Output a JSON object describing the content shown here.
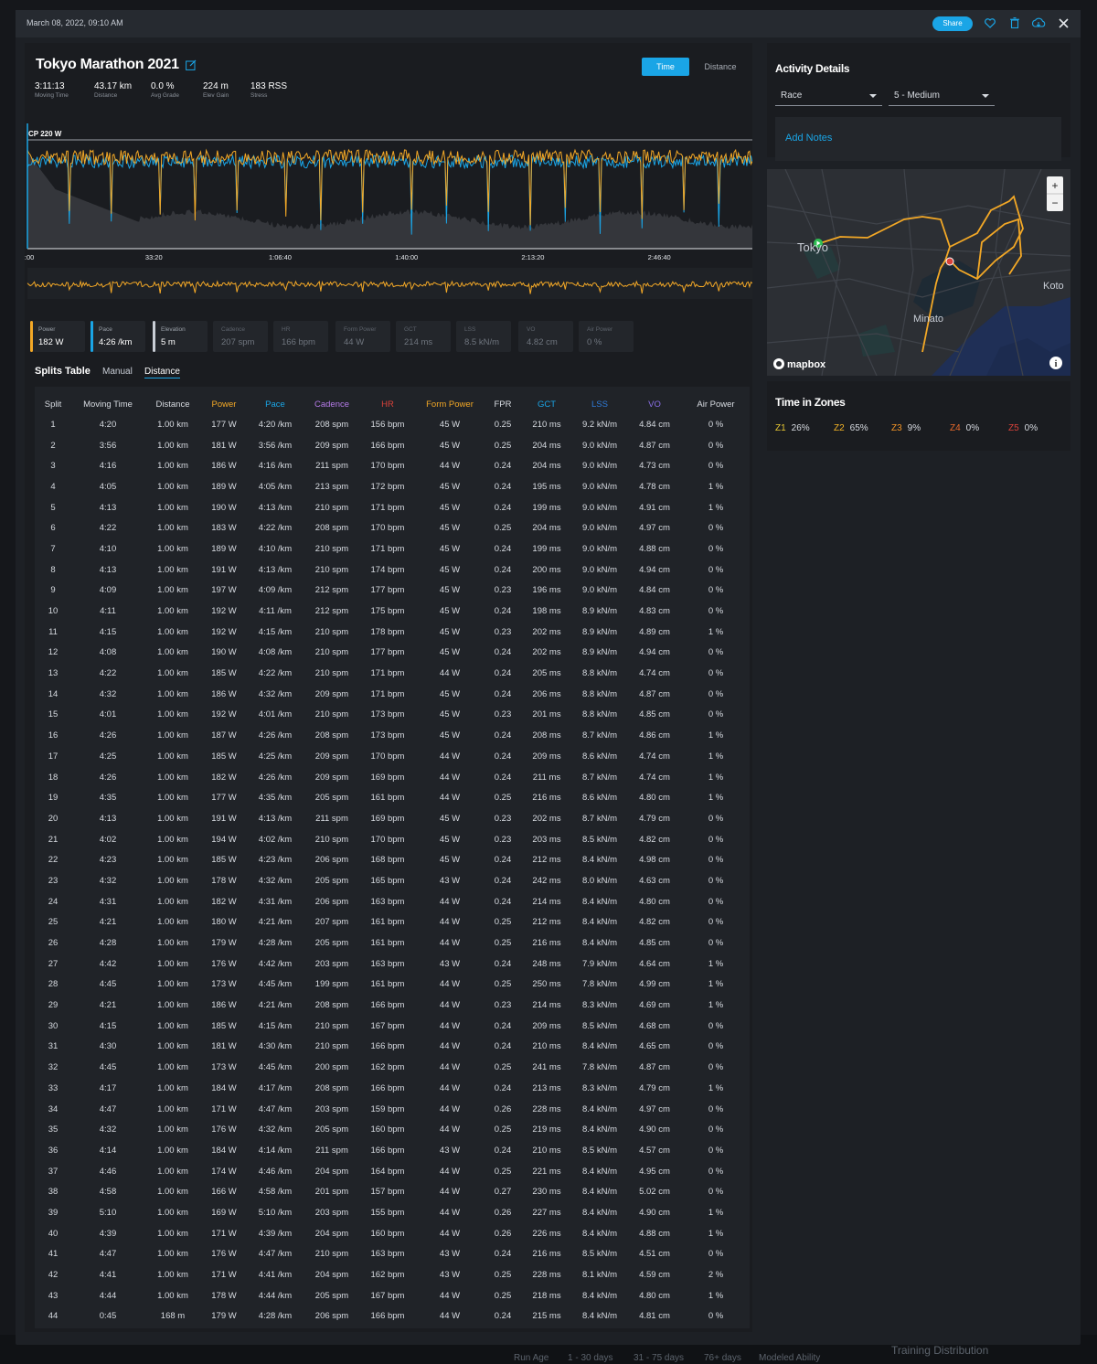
{
  "header": {
    "date": "March 08, 2022, 09:10 AM",
    "share_label": "Share"
  },
  "activity": {
    "title": "Tokyo Marathon 2021",
    "stats": [
      {
        "value": "3:11:13",
        "label": "Moving Time"
      },
      {
        "value": "43.17 km",
        "label": "Distance"
      },
      {
        "value": "0.0 %",
        "label": "Avg Grade"
      },
      {
        "value": "224 m",
        "label": "Elev Gain"
      },
      {
        "value": "183 RSS",
        "label": "Stress"
      }
    ],
    "toggle": {
      "time": "Time",
      "distance": "Distance"
    }
  },
  "chart_data": {
    "type": "line",
    "title": "",
    "cp_label": "CP 220 W",
    "x_ticks": [
      "0:00",
      "33:20",
      "1:06:40",
      "1:40:00",
      "2:13:20",
      "2:46:40"
    ],
    "series": [
      {
        "name": "Power",
        "color": "#f3a826"
      },
      {
        "name": "Pace",
        "color": "#1aa5e6"
      },
      {
        "name": "Elevation",
        "color": "#8c9099"
      }
    ],
    "grid": false
  },
  "metrics": [
    {
      "label": "Power",
      "value": "182 W",
      "color": "#f3a826",
      "active": true
    },
    {
      "label": "Pace",
      "value": "4:26 /km",
      "color": "#1aa5e6",
      "active": true
    },
    {
      "label": "Elevation",
      "value": "5 m",
      "color": "#c9ced6",
      "active": true
    },
    {
      "label": "Cadence",
      "value": "207 spm",
      "active": false
    },
    {
      "label": "HR",
      "value": "166 bpm",
      "active": false
    },
    {
      "label": "Form Power",
      "value": "44 W",
      "active": false
    },
    {
      "label": "GCT",
      "value": "214 ms",
      "active": false
    },
    {
      "label": "LSS",
      "value": "8.5 kN/m",
      "active": false
    },
    {
      "label": "VO",
      "value": "4.82 cm",
      "active": false
    },
    {
      "label": "Air Power",
      "value": "0 %",
      "active": false
    }
  ],
  "splits_tabs": {
    "title": "Splits Table",
    "manual": "Manual",
    "distance": "Distance"
  },
  "splits": {
    "columns": [
      {
        "label": "Split",
        "color": "#d8dce2"
      },
      {
        "label": "Moving Time",
        "color": "#d8dce2"
      },
      {
        "label": "Distance",
        "color": "#d8dce2"
      },
      {
        "label": "Power",
        "color": "#f3a826"
      },
      {
        "label": "Pace",
        "color": "#1aa5e6"
      },
      {
        "label": "Cadence",
        "color": "#b57be8"
      },
      {
        "label": "HR",
        "color": "#d9423a"
      },
      {
        "label": "Form Power",
        "color": "#f3a826"
      },
      {
        "label": "FPR",
        "color": "#d8dce2"
      },
      {
        "label": "GCT",
        "color": "#1aa5e6"
      },
      {
        "label": "LSS",
        "color": "#2f7bd9"
      },
      {
        "label": "VO",
        "color": "#8a6ee6"
      },
      {
        "label": "Air Power",
        "color": "#d8dce2"
      }
    ],
    "rows": [
      [
        "1",
        "4:20",
        "1.00 km",
        "177 W",
        "4:20 /km",
        "208 spm",
        "156 bpm",
        "45 W",
        "0.25",
        "210 ms",
        "9.2 kN/m",
        "4.84 cm",
        "0 %"
      ],
      [
        "2",
        "3:56",
        "1.00 km",
        "181 W",
        "3:56 /km",
        "209 spm",
        "166 bpm",
        "45 W",
        "0.25",
        "204 ms",
        "9.0 kN/m",
        "4.87 cm",
        "0 %"
      ],
      [
        "3",
        "4:16",
        "1.00 km",
        "186 W",
        "4:16 /km",
        "211 spm",
        "170 bpm",
        "44 W",
        "0.24",
        "204 ms",
        "9.0 kN/m",
        "4.73 cm",
        "0 %"
      ],
      [
        "4",
        "4:05",
        "1.00 km",
        "189 W",
        "4:05 /km",
        "213 spm",
        "172 bpm",
        "45 W",
        "0.24",
        "195 ms",
        "9.0 kN/m",
        "4.78 cm",
        "1 %"
      ],
      [
        "5",
        "4:13",
        "1.00 km",
        "190 W",
        "4:13 /km",
        "210 spm",
        "171 bpm",
        "45 W",
        "0.24",
        "199 ms",
        "9.0 kN/m",
        "4.91 cm",
        "1 %"
      ],
      [
        "6",
        "4:22",
        "1.00 km",
        "183 W",
        "4:22 /km",
        "208 spm",
        "170 bpm",
        "45 W",
        "0.25",
        "204 ms",
        "9.0 kN/m",
        "4.97 cm",
        "0 %"
      ],
      [
        "7",
        "4:10",
        "1.00 km",
        "189 W",
        "4:10 /km",
        "210 spm",
        "171 bpm",
        "45 W",
        "0.24",
        "199 ms",
        "9.0 kN/m",
        "4.88 cm",
        "0 %"
      ],
      [
        "8",
        "4:13",
        "1.00 km",
        "191 W",
        "4:13 /km",
        "210 spm",
        "174 bpm",
        "45 W",
        "0.24",
        "200 ms",
        "9.0 kN/m",
        "4.94 cm",
        "0 %"
      ],
      [
        "9",
        "4:09",
        "1.00 km",
        "197 W",
        "4:09 /km",
        "212 spm",
        "177 bpm",
        "45 W",
        "0.23",
        "196 ms",
        "9.0 kN/m",
        "4.84 cm",
        "0 %"
      ],
      [
        "10",
        "4:11",
        "1.00 km",
        "192 W",
        "4:11 /km",
        "212 spm",
        "175 bpm",
        "45 W",
        "0.24",
        "198 ms",
        "8.9 kN/m",
        "4.83 cm",
        "0 %"
      ],
      [
        "11",
        "4:15",
        "1.00 km",
        "192 W",
        "4:15 /km",
        "210 spm",
        "178 bpm",
        "45 W",
        "0.23",
        "202 ms",
        "8.9 kN/m",
        "4.89 cm",
        "1 %"
      ],
      [
        "12",
        "4:08",
        "1.00 km",
        "190 W",
        "4:08 /km",
        "210 spm",
        "177 bpm",
        "45 W",
        "0.24",
        "202 ms",
        "8.9 kN/m",
        "4.94 cm",
        "0 %"
      ],
      [
        "13",
        "4:22",
        "1.00 km",
        "185 W",
        "4:22 /km",
        "210 spm",
        "171 bpm",
        "44 W",
        "0.24",
        "205 ms",
        "8.8 kN/m",
        "4.74 cm",
        "0 %"
      ],
      [
        "14",
        "4:32",
        "1.00 km",
        "186 W",
        "4:32 /km",
        "209 spm",
        "171 bpm",
        "45 W",
        "0.24",
        "206 ms",
        "8.8 kN/m",
        "4.87 cm",
        "0 %"
      ],
      [
        "15",
        "4:01",
        "1.00 km",
        "192 W",
        "4:01 /km",
        "210 spm",
        "173 bpm",
        "45 W",
        "0.23",
        "201 ms",
        "8.8 kN/m",
        "4.85 cm",
        "0 %"
      ],
      [
        "16",
        "4:26",
        "1.00 km",
        "187 W",
        "4:26 /km",
        "208 spm",
        "173 bpm",
        "45 W",
        "0.24",
        "208 ms",
        "8.7 kN/m",
        "4.86 cm",
        "1 %"
      ],
      [
        "17",
        "4:25",
        "1.00 km",
        "185 W",
        "4:25 /km",
        "209 spm",
        "170 bpm",
        "44 W",
        "0.24",
        "209 ms",
        "8.6 kN/m",
        "4.74 cm",
        "1 %"
      ],
      [
        "18",
        "4:26",
        "1.00 km",
        "182 W",
        "4:26 /km",
        "209 spm",
        "169 bpm",
        "44 W",
        "0.24",
        "211 ms",
        "8.7 kN/m",
        "4.74 cm",
        "1 %"
      ],
      [
        "19",
        "4:35",
        "1.00 km",
        "177 W",
        "4:35 /km",
        "205 spm",
        "161 bpm",
        "44 W",
        "0.25",
        "216 ms",
        "8.6 kN/m",
        "4.80 cm",
        "1 %"
      ],
      [
        "20",
        "4:13",
        "1.00 km",
        "191 W",
        "4:13 /km",
        "211 spm",
        "169 bpm",
        "45 W",
        "0.23",
        "202 ms",
        "8.7 kN/m",
        "4.79 cm",
        "0 %"
      ],
      [
        "21",
        "4:02",
        "1.00 km",
        "194 W",
        "4:02 /km",
        "210 spm",
        "170 bpm",
        "45 W",
        "0.23",
        "203 ms",
        "8.5 kN/m",
        "4.82 cm",
        "0 %"
      ],
      [
        "22",
        "4:23",
        "1.00 km",
        "185 W",
        "4:23 /km",
        "206 spm",
        "168 bpm",
        "45 W",
        "0.24",
        "212 ms",
        "8.4 kN/m",
        "4.98 cm",
        "0 %"
      ],
      [
        "23",
        "4:32",
        "1.00 km",
        "178 W",
        "4:32 /km",
        "205 spm",
        "165 bpm",
        "43 W",
        "0.24",
        "242 ms",
        "8.0 kN/m",
        "4.63 cm",
        "0 %"
      ],
      [
        "24",
        "4:31",
        "1.00 km",
        "182 W",
        "4:31 /km",
        "206 spm",
        "163 bpm",
        "44 W",
        "0.24",
        "214 ms",
        "8.4 kN/m",
        "4.80 cm",
        "0 %"
      ],
      [
        "25",
        "4:21",
        "1.00 km",
        "180 W",
        "4:21 /km",
        "207 spm",
        "161 bpm",
        "44 W",
        "0.25",
        "212 ms",
        "8.4 kN/m",
        "4.82 cm",
        "0 %"
      ],
      [
        "26",
        "4:28",
        "1.00 km",
        "179 W",
        "4:28 /km",
        "205 spm",
        "161 bpm",
        "44 W",
        "0.25",
        "216 ms",
        "8.4 kN/m",
        "4.85 cm",
        "0 %"
      ],
      [
        "27",
        "4:42",
        "1.00 km",
        "176 W",
        "4:42 /km",
        "203 spm",
        "163 bpm",
        "43 W",
        "0.24",
        "248 ms",
        "7.9 kN/m",
        "4.64 cm",
        "1 %"
      ],
      [
        "28",
        "4:45",
        "1.00 km",
        "173 W",
        "4:45 /km",
        "199 spm",
        "161 bpm",
        "44 W",
        "0.25",
        "250 ms",
        "7.8 kN/m",
        "4.99 cm",
        "1 %"
      ],
      [
        "29",
        "4:21",
        "1.00 km",
        "186 W",
        "4:21 /km",
        "208 spm",
        "166 bpm",
        "44 W",
        "0.23",
        "214 ms",
        "8.3 kN/m",
        "4.69 cm",
        "1 %"
      ],
      [
        "30",
        "4:15",
        "1.00 km",
        "185 W",
        "4:15 /km",
        "210 spm",
        "167 bpm",
        "44 W",
        "0.24",
        "209 ms",
        "8.5 kN/m",
        "4.68 cm",
        "0 %"
      ],
      [
        "31",
        "4:30",
        "1.00 km",
        "181 W",
        "4:30 /km",
        "210 spm",
        "166 bpm",
        "44 W",
        "0.24",
        "210 ms",
        "8.4 kN/m",
        "4.65 cm",
        "0 %"
      ],
      [
        "32",
        "4:45",
        "1.00 km",
        "173 W",
        "4:45 /km",
        "200 spm",
        "162 bpm",
        "44 W",
        "0.25",
        "241 ms",
        "7.8 kN/m",
        "4.87 cm",
        "0 %"
      ],
      [
        "33",
        "4:17",
        "1.00 km",
        "184 W",
        "4:17 /km",
        "208 spm",
        "166 bpm",
        "44 W",
        "0.24",
        "213 ms",
        "8.3 kN/m",
        "4.79 cm",
        "1 %"
      ],
      [
        "34",
        "4:47",
        "1.00 km",
        "171 W",
        "4:47 /km",
        "203 spm",
        "159 bpm",
        "44 W",
        "0.26",
        "228 ms",
        "8.4 kN/m",
        "4.97 cm",
        "0 %"
      ],
      [
        "35",
        "4:32",
        "1.00 km",
        "176 W",
        "4:32 /km",
        "205 spm",
        "160 bpm",
        "44 W",
        "0.25",
        "219 ms",
        "8.4 kN/m",
        "4.90 cm",
        "0 %"
      ],
      [
        "36",
        "4:14",
        "1.00 km",
        "184 W",
        "4:14 /km",
        "211 spm",
        "166 bpm",
        "43 W",
        "0.24",
        "210 ms",
        "8.5 kN/m",
        "4.57 cm",
        "0 %"
      ],
      [
        "37",
        "4:46",
        "1.00 km",
        "174 W",
        "4:46 /km",
        "204 spm",
        "164 bpm",
        "44 W",
        "0.25",
        "221 ms",
        "8.4 kN/m",
        "4.95 cm",
        "0 %"
      ],
      [
        "38",
        "4:58",
        "1.00 km",
        "166 W",
        "4:58 /km",
        "201 spm",
        "157 bpm",
        "44 W",
        "0.27",
        "230 ms",
        "8.4 kN/m",
        "5.02 cm",
        "0 %"
      ],
      [
        "39",
        "5:10",
        "1.00 km",
        "169 W",
        "5:10 /km",
        "203 spm",
        "155 bpm",
        "44 W",
        "0.26",
        "227 ms",
        "8.4 kN/m",
        "4.90 cm",
        "1 %"
      ],
      [
        "40",
        "4:39",
        "1.00 km",
        "171 W",
        "4:39 /km",
        "204 spm",
        "160 bpm",
        "44 W",
        "0.26",
        "226 ms",
        "8.4 kN/m",
        "4.88 cm",
        "1 %"
      ],
      [
        "41",
        "4:47",
        "1.00 km",
        "176 W",
        "4:47 /km",
        "210 spm",
        "163 bpm",
        "43 W",
        "0.24",
        "216 ms",
        "8.5 kN/m",
        "4.51 cm",
        "0 %"
      ],
      [
        "42",
        "4:41",
        "1.00 km",
        "171 W",
        "4:41 /km",
        "204 spm",
        "162 bpm",
        "43 W",
        "0.25",
        "228 ms",
        "8.1 kN/m",
        "4.59 cm",
        "2 %"
      ],
      [
        "43",
        "4:44",
        "1.00 km",
        "178 W",
        "4:44 /km",
        "205 spm",
        "167 bpm",
        "44 W",
        "0.25",
        "218 ms",
        "8.4 kN/m",
        "4.80 cm",
        "1 %"
      ],
      [
        "44",
        "0:45",
        "168 m",
        "179 W",
        "4:28 /km",
        "206 spm",
        "166 bpm",
        "44 W",
        "0.24",
        "215 ms",
        "8.4 kN/m",
        "4.81 cm",
        "0 %"
      ]
    ]
  },
  "details": {
    "title": "Activity Details",
    "type_value": "Race",
    "rpe_value": "5 - Medium",
    "notes_label": "Add Notes"
  },
  "map": {
    "labels": [
      "Tokyo",
      "Koto",
      "Minato"
    ],
    "attribution": "mapbox",
    "zoom_in": "+",
    "zoom_out": "−"
  },
  "zones": {
    "title": "Time in Zones",
    "items": [
      {
        "name": "Z1",
        "value": "26%",
        "color": "#e8c832"
      },
      {
        "name": "Z2",
        "value": "65%",
        "color": "#f3b326"
      },
      {
        "name": "Z3",
        "value": "9%",
        "color": "#f39426"
      },
      {
        "name": "Z4",
        "value": "0%",
        "color": "#e86a2a"
      },
      {
        "name": "Z5",
        "value": "0%",
        "color": "#d9423a"
      }
    ]
  },
  "background": {
    "footer_items": [
      "Run Age",
      "1 - 30 days",
      "31 - 75 days",
      "76+ days",
      "Modeled Ability",
      "Training Distribution"
    ]
  }
}
